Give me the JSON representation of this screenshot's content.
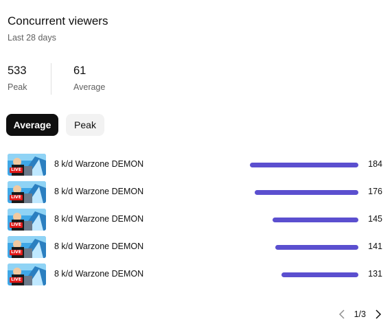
{
  "header": {
    "title": "Concurrent viewers",
    "subtitle": "Last 28 days"
  },
  "stats": {
    "peak": {
      "value": "533",
      "label": "Peak"
    },
    "average": {
      "value": "61",
      "label": "Average"
    }
  },
  "toggle": {
    "options": [
      "Average",
      "Peak"
    ],
    "selected": "Average"
  },
  "videos": [
    {
      "title": "8 k/d Warzone DEMON",
      "value": 184,
      "badge": "LIVE"
    },
    {
      "title": "8 k/d Warzone DEMON",
      "value": 176,
      "badge": "LIVE"
    },
    {
      "title": "8 k/d Warzone DEMON",
      "value": 145,
      "badge": "LIVE"
    },
    {
      "title": "8 k/d Warzone DEMON",
      "value": 141,
      "badge": "LIVE"
    },
    {
      "title": "8 k/d Warzone DEMON",
      "value": 131,
      "badge": "LIVE"
    }
  ],
  "pagination": {
    "text": "1/3",
    "prev_icon": "chevron-left-icon",
    "next_icon": "chevron-right-icon"
  },
  "colors": {
    "bar": "#5b4fcf",
    "live_badge": "#e01818",
    "chip_active": "#0f0f0f"
  }
}
